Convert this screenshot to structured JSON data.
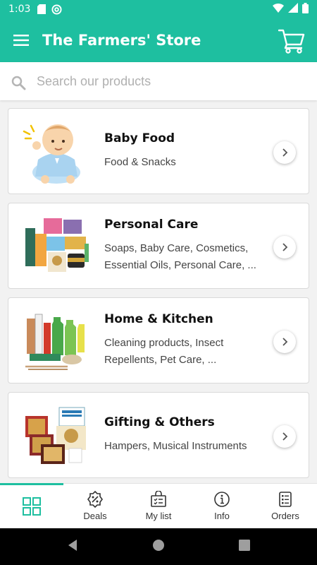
{
  "status_bar": {
    "time": "1:03"
  },
  "app_bar": {
    "title": "The Farmers' Store"
  },
  "search": {
    "placeholder": "Search our products",
    "value": ""
  },
  "categories": [
    {
      "title": "Baby Food",
      "subtitle": "Food & Snacks"
    },
    {
      "title": "Personal Care",
      "subtitle": "Soaps, Baby Care, Cosmetics, Essential Oils, Personal Care, ..."
    },
    {
      "title": "Home & Kitchen",
      "subtitle": "Cleaning products, Insect Repellents, Pet Care, ..."
    },
    {
      "title": "Gifting & Others",
      "subtitle": "Hampers, Musical Instruments"
    }
  ],
  "tabs": [
    {
      "label": "",
      "icon": "grid-icon",
      "active": true
    },
    {
      "label": "Deals",
      "icon": "discount-badge-icon"
    },
    {
      "label": "My list",
      "icon": "shopping-list-icon"
    },
    {
      "label": "Info",
      "icon": "info-icon"
    },
    {
      "label": "Orders",
      "icon": "orders-icon"
    }
  ],
  "colors": {
    "accent": "#1ebfa0"
  }
}
